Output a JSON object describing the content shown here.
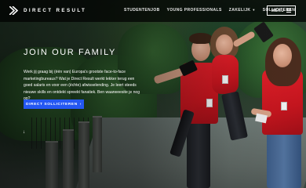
{
  "header": {
    "logo_text": "DIRECT RESULT",
    "nav": [
      {
        "label": "STUDENTENJOB"
      },
      {
        "label": "YOUNG PROFESSIONALS"
      },
      {
        "label": "ZAKELIJK"
      },
      {
        "label": "SOLLICITEREN"
      }
    ],
    "menu_label": "MENU"
  },
  "hero": {
    "title": "JOIN OUR FAMILY",
    "text": "Werk jij graag bij (één van) Europa's grootste face-to-face marketingbureaus? Wat je Direct Result werkt lekker terug een goed salaris en voor een (échte) afwisselending. Je leert steeds nieuwe skills en ontdekt spreekt fanatiek. Ben waarweesite je nog op?",
    "cta_label": "DIRECT SOLLICITEREN",
    "cta_arrow": "›",
    "scroll_icon": "↓"
  },
  "colors": {
    "accent": "#2457f2",
    "shirt_red": "#d81b24",
    "header_bg": "#000000"
  },
  "icons": {
    "logo": "direct-result-logo-icon",
    "menu": "hamburger-icon",
    "dropdown": "chevron-down-icon",
    "scroll": "arrow-down-icon"
  }
}
